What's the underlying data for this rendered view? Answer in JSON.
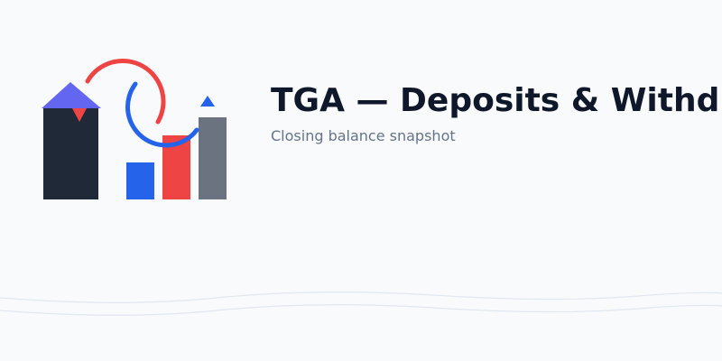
{
  "header": {
    "title": "TGA — Deposits & Withdrawals",
    "subtitle": "Closing balance snapshot"
  },
  "logo": {
    "icon": "bank-cashflow-icon",
    "colors": {
      "navy": "#1f2937",
      "purple": "#6366f1",
      "blue": "#2563eb",
      "red": "#ef4444",
      "slate": "#6b7280"
    }
  },
  "theme": {
    "background": "#f8fafc",
    "title_color": "#0f172a",
    "subtitle_color": "#64748b",
    "wave_color": "#e2e8f0"
  }
}
